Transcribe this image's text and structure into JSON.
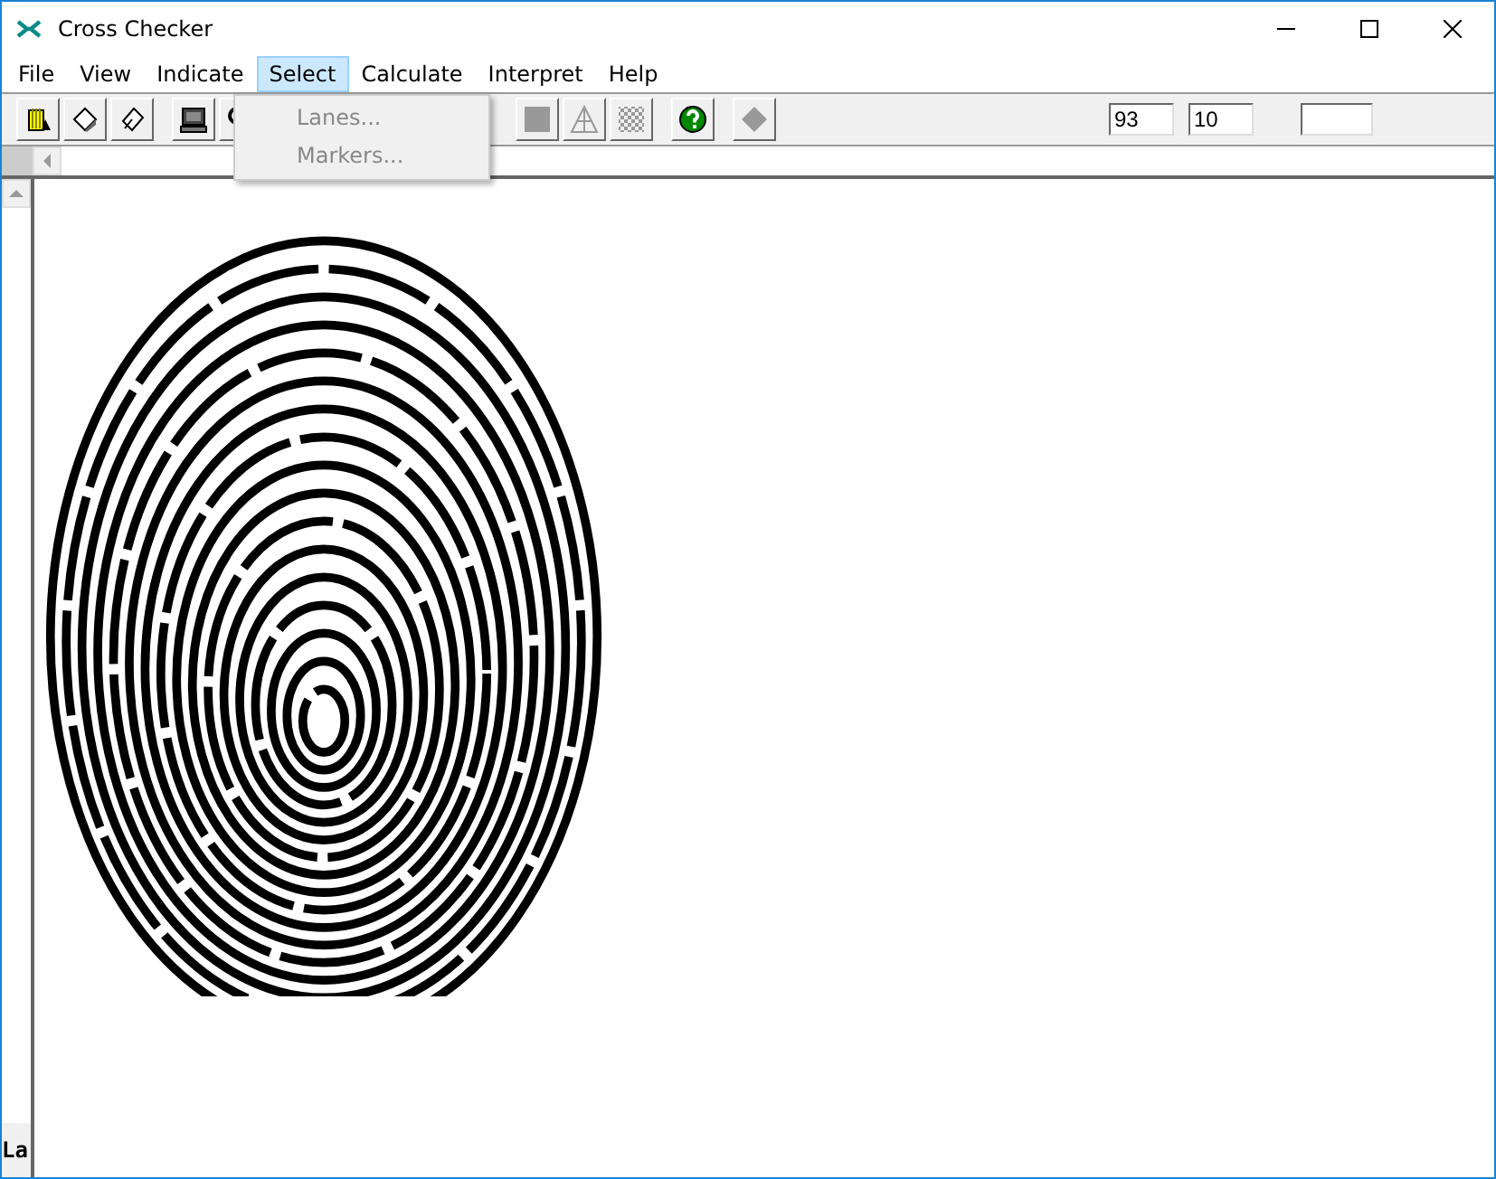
{
  "window": {
    "title": "Cross Checker"
  },
  "menu": [
    {
      "label": "File",
      "selected": false
    },
    {
      "label": "View",
      "selected": false
    },
    {
      "label": "Indicate",
      "selected": false
    },
    {
      "label": "Select",
      "selected": true
    },
    {
      "label": "Calculate",
      "selected": false
    },
    {
      "label": "Interpret",
      "selected": false
    },
    {
      "label": "Help",
      "selected": false
    }
  ],
  "dropdown": [
    {
      "label": "Lanes...",
      "disabled": true
    },
    {
      "label": "Markers...",
      "disabled": true
    }
  ],
  "fields": [
    {
      "value": "93"
    },
    {
      "value": "10"
    }
  ],
  "corner_label": "La"
}
